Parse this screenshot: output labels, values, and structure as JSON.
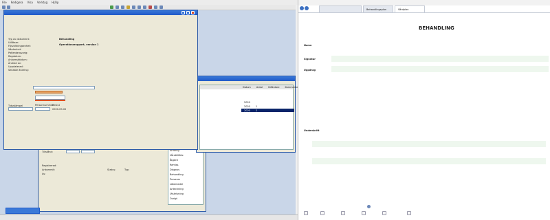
{
  "menubar": [
    "File",
    "Redigera",
    "Visa",
    "Verktyg",
    "Hjälp"
  ],
  "dialog_main": {
    "title": "",
    "top_labels": [
      "Typ av dokument:",
      "Utlåtare:",
      "Förvaltningsenhet:",
      "Vårdenhet:",
      "Patientansvarig:",
      "Regdatum:",
      "Ankomstdatum:",
      "Ändrad av:",
      "Uppdaterad:",
      "Senaste ändring:"
    ],
    "doc_type_value": "Behandling",
    "ref_value": "Operationsrapport, version 1",
    "mid_heading": "",
    "combo_value": "",
    "lower_labels": [
      "Tidsstämpel",
      "Personnummer",
      "Beslut",
      "Status"
    ],
    "status_value": "2020-09-02",
    "footer_lines": [
      "",
      ""
    ]
  },
  "dialog_grid": {
    "headers": [
      "",
      "",
      "",
      "Datum",
      "Antal",
      "Utfärdare",
      "Kommentar"
    ],
    "rows": [
      [
        "",
        "",
        "",
        "2020",
        "",
        "",
        ""
      ],
      [
        "",
        "",
        "",
        "2020",
        "1",
        "",
        ""
      ],
      [
        "",
        "",
        "",
        "2020",
        "2",
        "",
        ""
      ]
    ]
  },
  "dialog_lower": {
    "labels": [
      "Avdelning:",
      "Tillstånd:",
      "Registrerad:",
      "Ankommit:",
      "Av:"
    ],
    "values": [
      "",
      "",
      "",
      "",
      ""
    ],
    "right_labels": [
      "Status:",
      "Typ:"
    ],
    "right_values": [
      "",
      ""
    ],
    "list_items": [
      "Ändring",
      "Vårdtillfälle",
      "Åtgärd",
      "Remiss",
      "Diagnos",
      "Behandling",
      "Provsvar",
      "Läkemedel",
      "Anteckning",
      "Utskrivning",
      "Övrigt"
    ]
  },
  "statusbar": {
    "text": ""
  },
  "browser": {
    "tabs": [
      "",
      "Behandlingsplan",
      "Vårdplan"
    ],
    "url": "",
    "page_title": "BEHANDLING",
    "page_title_right": "",
    "subtitle": "",
    "meta_right_1": "",
    "meta_right_red": "",
    "row_labels": [
      "Namn",
      "Signatur",
      "Uppdrag",
      "Underskrift"
    ],
    "row1_value": "",
    "para1": "",
    "para2": "",
    "para3": "",
    "sign_rows": [
      {
        "left_label": "",
        "left_value": "",
        "right_label": "",
        "right_value": ""
      },
      {
        "left_label": "",
        "left_value": "",
        "right_label": "",
        "right_value": ""
      },
      {
        "left_label": "",
        "left_value": "",
        "right_label": "",
        "right_value": ""
      }
    ],
    "footer_note": "",
    "bottom_buttons": [
      "",
      "",
      "",
      "",
      "",
      ""
    ]
  }
}
